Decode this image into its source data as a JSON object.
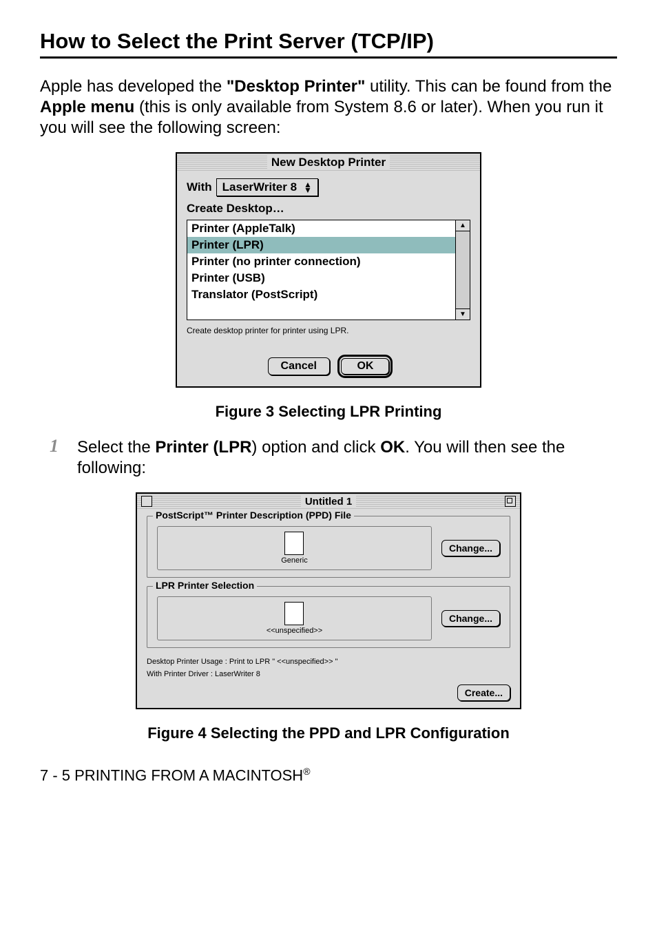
{
  "heading": "How to Select the Print Server (TCP/IP)",
  "intro_parts": {
    "p1": "Apple has developed the ",
    "b1": "\"Desktop Printer\"",
    "p2": " utility. This can be found from the ",
    "b2": "Apple menu",
    "p3": " (this is only available from System 8.6 or later). When you run it you will see the following screen:"
  },
  "dialog1": {
    "title": "New Desktop Printer",
    "with_label": "With",
    "with_value": "LaserWriter 8",
    "create_desktop": "Create Desktop…",
    "options": [
      "Printer (AppleTalk)",
      "Printer (LPR)",
      "Printer (no printer connection)",
      "Printer (USB)",
      "Translator (PostScript)"
    ],
    "hint": "Create desktop printer for printer using LPR.",
    "cancel": "Cancel",
    "ok": "OK"
  },
  "figure3_caption": "Figure 3 Selecting LPR Printing",
  "step1_parts": {
    "num": "1",
    "p1": "Select the ",
    "b1": "Printer (LPR",
    "p2": ") option and click ",
    "b2": "OK",
    "p3": ". You will then see the following:"
  },
  "dialog2": {
    "title": "Untitled 1",
    "group1_label": "PostScript™ Printer Description (PPD) File",
    "group1_preview": "Generic",
    "group2_label": "LPR Printer Selection",
    "group2_preview": "<<unspecified>>",
    "change": "Change...",
    "meta_line1": "Desktop Printer Usage : Print to LPR \" <<unspecified>> \"",
    "meta_line2": "With Printer Driver : LaserWriter 8",
    "create": "Create..."
  },
  "figure4_caption": "Figure 4 Selecting the PPD and LPR Configuration",
  "footer_parts": {
    "p1": "7 - 5 PRINTING FROM A MACINTOSH",
    "sup": "®"
  }
}
